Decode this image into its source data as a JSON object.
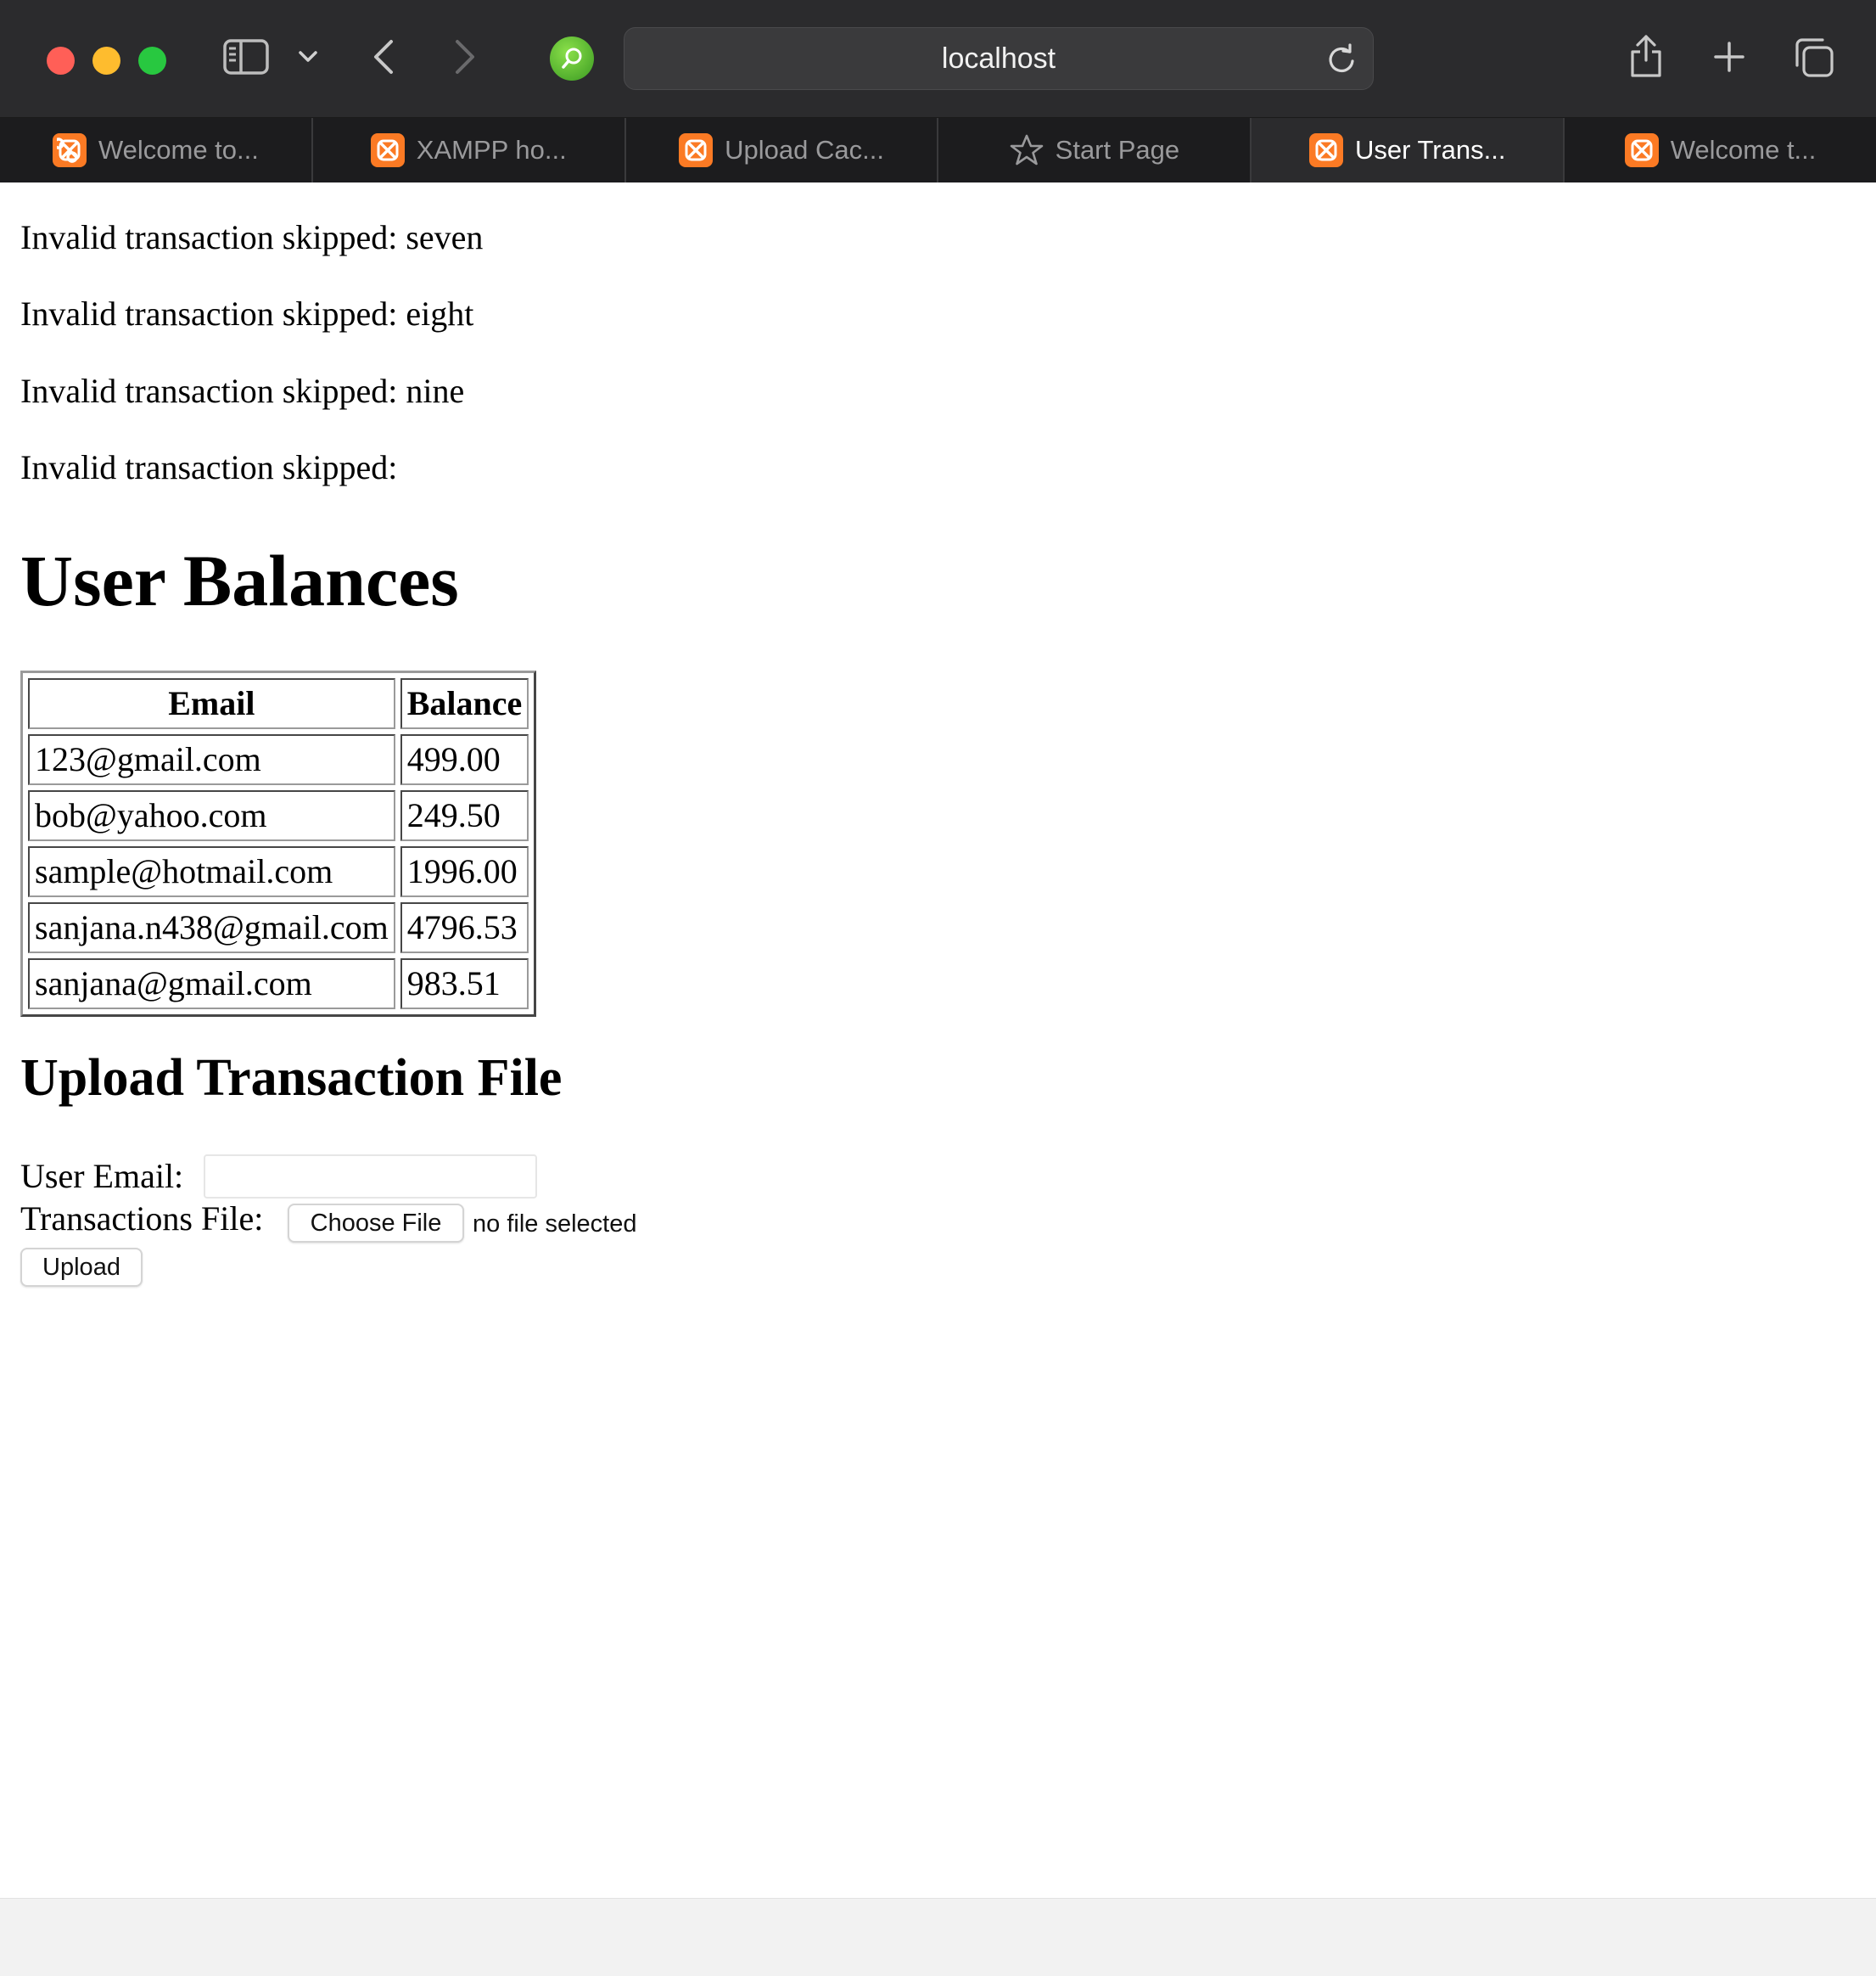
{
  "browser": {
    "address": "localhost",
    "tabs": [
      {
        "label": "Welcome to...",
        "icon": "xampp-favicon",
        "active": false
      },
      {
        "label": "XAMPP ho...",
        "icon": "xampp-favicon",
        "active": false
      },
      {
        "label": "Upload Cac...",
        "icon": "xampp-favicon",
        "active": false
      },
      {
        "label": "Start Page",
        "icon": "star-icon",
        "active": false
      },
      {
        "label": "User Trans...",
        "icon": "xampp-favicon",
        "active": true
      },
      {
        "label": "Welcome t...",
        "icon": "xampp-favicon",
        "active": false
      }
    ]
  },
  "page": {
    "messages": [
      "Invalid transaction skipped: seven",
      "Invalid transaction skipped: eight",
      "Invalid transaction skipped: nine",
      "Invalid transaction skipped:"
    ],
    "balances_title": "User Balances",
    "table": {
      "headers": [
        "Email",
        "Balance"
      ],
      "rows": [
        [
          "123@gmail.com",
          "499.00"
        ],
        [
          "bob@yahoo.com",
          "249.50"
        ],
        [
          "sample@hotmail.com",
          "1996.00"
        ],
        [
          "sanjana.n438@gmail.com",
          "4796.53"
        ],
        [
          "sanjana@gmail.com",
          "983.51"
        ]
      ]
    },
    "upload_title": "Upload Transaction File",
    "form": {
      "email_label": "User Email:",
      "email_value": "",
      "file_label": "Transactions File:",
      "choose_label": "Choose File",
      "file_status": "no file selected",
      "upload_label": "Upload"
    }
  },
  "colors": {
    "toolbar": "#2b2b2d",
    "tabstrip": "#1c1c1e",
    "xampp_orange": "#fb7a24",
    "traffic_red": "#ff5f57",
    "traffic_yellow": "#febc2e",
    "traffic_green": "#28c840"
  }
}
